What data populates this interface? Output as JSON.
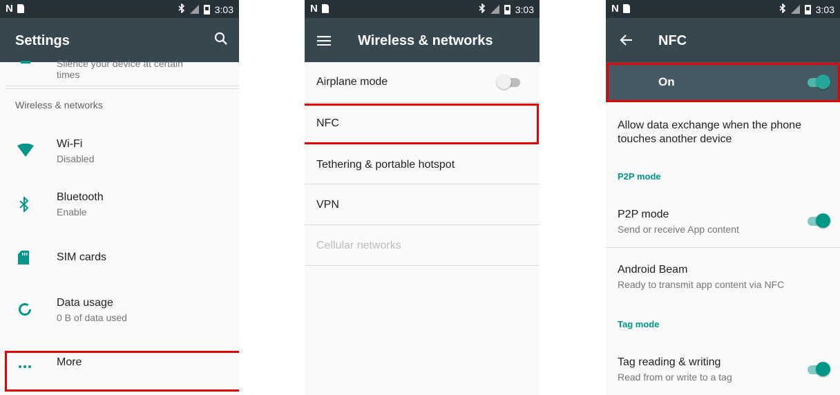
{
  "status_bar": {
    "time": "3:03",
    "left_glyph": "N",
    "icons": [
      "nfc-icon",
      "sdcard-icon",
      "bluetooth-icon",
      "no-signal-icon",
      "battery-icon"
    ]
  },
  "colors": {
    "status_bar": "#263238",
    "toolbar": "#37474f",
    "accent": "#009688",
    "highlight": "#e60000"
  },
  "screen1": {
    "title": "Settings",
    "partial_item": {
      "line1": "Silence your device at certain",
      "line2": "times"
    },
    "category": "Wireless & networks",
    "items": [
      {
        "icon": "wifi-icon",
        "title": "Wi-Fi",
        "summary": "Disabled"
      },
      {
        "icon": "bluetooth-icon",
        "title": "Bluetooth",
        "summary": "Enable"
      },
      {
        "icon": "sim-card-icon",
        "title": "SIM cards"
      },
      {
        "icon": "data-usage-icon",
        "title": "Data usage",
        "summary": "0 B of data used"
      },
      {
        "icon": "more-icon",
        "title": "More"
      }
    ]
  },
  "screen2": {
    "title": "Wireless & networks",
    "items": [
      {
        "label": "Airplane mode",
        "toggle": false
      },
      {
        "label": "NFC"
      },
      {
        "label": "Tethering & portable hotspot"
      },
      {
        "label": "VPN"
      },
      {
        "label": "Cellular networks",
        "disabled": true
      }
    ]
  },
  "screen3": {
    "title": "NFC",
    "master_label": "On",
    "description": [
      "Allow data exchange when the phone",
      "touches another device"
    ],
    "sections": [
      {
        "header": "P2P mode",
        "items": [
          {
            "title": "P2P mode",
            "summary": "Send or receive App content",
            "toggle": true
          },
          {
            "title": "Android Beam",
            "summary": "Ready to transmit app content via NFC"
          }
        ]
      },
      {
        "header": "Tag mode",
        "items": [
          {
            "title": "Tag reading & writing",
            "summary": "Read from or write to a tag",
            "toggle": true
          }
        ]
      }
    ]
  }
}
